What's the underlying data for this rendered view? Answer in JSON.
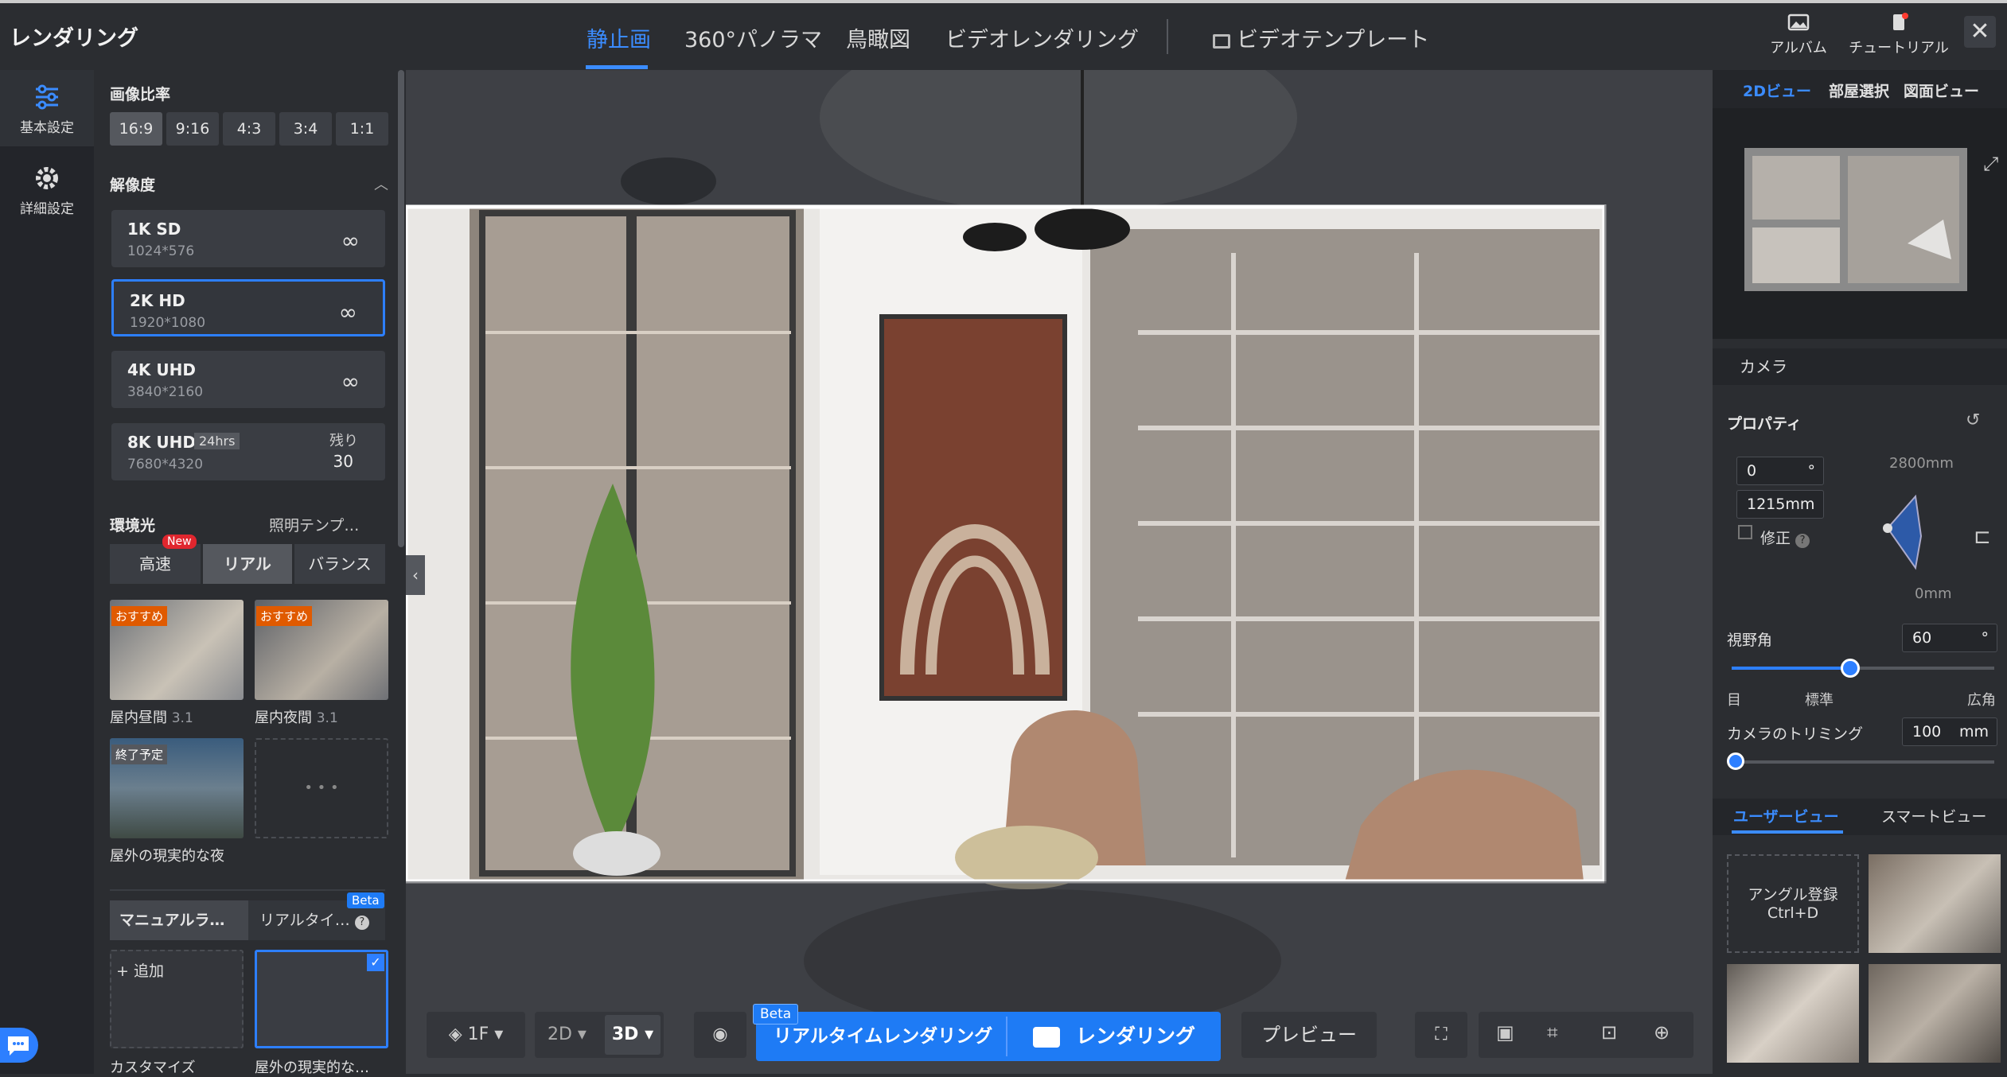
{
  "header": {
    "title": "レンダリング",
    "tabs": [
      "静止画",
      "360°パノラマ",
      "鳥瞰図",
      "ビデオレンダリング"
    ],
    "video_template": "ビデオテンプレート",
    "album": "アルバム",
    "tutorial": "チュートリアル",
    "close": "✕"
  },
  "nav": {
    "basic": "基本設定",
    "advanced": "詳細設定"
  },
  "left_panel": {
    "aspect_title": "画像比率",
    "aspects": [
      "16:9",
      "9:16",
      "4:3",
      "3:4",
      "1:1"
    ],
    "resolution_title": "解像度",
    "resolutions": [
      {
        "name": "1K SD",
        "dims": "1024*576"
      },
      {
        "name": "2K HD",
        "dims": "1920*1080"
      },
      {
        "name": "4K UHD",
        "dims": "3840*2160"
      },
      {
        "name": "8K UHD",
        "dims": "7680*4320",
        "badge": "24hrs",
        "remain_label": "残り",
        "remain": "30"
      }
    ],
    "lighting_title": "環境光",
    "lighting_template": "照明テンプ…",
    "modes": [
      "高速",
      "リアル",
      "バランス"
    ],
    "new_badge": "New",
    "presets": [
      {
        "tag": "おすすめ",
        "name": "屋内昼間",
        "ver": "3.1"
      },
      {
        "tag": "おすすめ",
        "name": "屋内夜間",
        "ver": "3.1"
      },
      {
        "tag": "終了予定",
        "name": "屋外の現実的な夜"
      }
    ],
    "more": "• • •",
    "manual_tab": "マニュアルラ…",
    "realtime_tab": "リアルタイ…",
    "beta": "Beta",
    "add": "+ 追加",
    "custom": "カスタマイズ",
    "outdoor_real": "屋外の現実的な…"
  },
  "bottom_toolbar": {
    "floor": "1F",
    "view2d": "2D",
    "view3d": "3D",
    "beta": "Beta",
    "realtime_render": "リアルタイムレンダリング",
    "render": "レンダリング",
    "preview": "プレビュー"
  },
  "right_panel": {
    "tabs": [
      "2Dビュー",
      "部屋選択",
      "図面ビュー"
    ],
    "camera_title": "カメラ",
    "property_title": "プロパティ",
    "angle": "0",
    "angle_unit": "°",
    "height": "1215mm",
    "correct": "修正",
    "max_height": "2800mm",
    "min_height": "0mm",
    "fov_label": "視野角",
    "fov": "60",
    "fov_unit": "°",
    "fov_slider": {
      "value": 0.45
    },
    "fov_marks": [
      "目",
      "標準",
      "広角"
    ],
    "trim_label": "カメラのトリミング",
    "trim": "100",
    "trim_unit": "mm",
    "view_tabs": [
      "ユーザービュー",
      "スマートビュー"
    ],
    "angle_register": "アングル登録",
    "shortcut": "Ctrl+D"
  },
  "colors": {
    "accent": "#1e7bf5",
    "active_tab": "#3b8cff",
    "tag": "#e05a00"
  }
}
